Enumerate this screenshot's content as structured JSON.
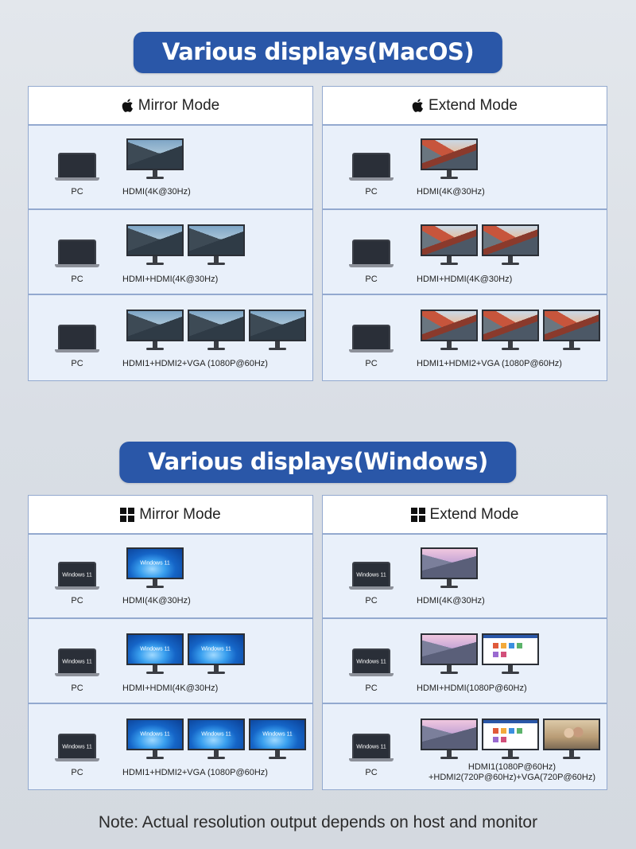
{
  "sections": [
    {
      "title": "Various displays(MacOS)",
      "os": "macos",
      "panels": [
        {
          "header": "Mirror Mode",
          "icon": "apple-icon",
          "rows": [
            {
              "pc_label": "PC",
              "connection": "HDMI(4K@30Hz)",
              "monitors": [
                "yosemite"
              ]
            },
            {
              "pc_label": "PC",
              "connection": "HDMI+HDMI(4K@30Hz)",
              "monitors": [
                "yosemite",
                "yosemite"
              ]
            },
            {
              "pc_label": "PC",
              "connection": "HDMI1+HDMI2+VGA (1080P@60Hz)",
              "monitors": [
                "yosemite",
                "yosemite",
                "yosemite"
              ]
            }
          ]
        },
        {
          "header": "Extend Mode",
          "icon": "apple-icon",
          "rows": [
            {
              "pc_label": "PC",
              "connection": "HDMI(4K@30Hz)",
              "monitors": [
                "sierra"
              ]
            },
            {
              "pc_label": "PC",
              "connection": "HDMI+HDMI(4K@30Hz)",
              "monitors": [
                "sierra",
                "sierra"
              ]
            },
            {
              "pc_label": "PC",
              "connection": "HDMI1+HDMI2+VGA (1080P@60Hz)",
              "monitors": [
                "sierra",
                "sierra",
                "sierra"
              ]
            }
          ]
        }
      ]
    },
    {
      "title": "Various displays(Windows)",
      "os": "windows",
      "panels": [
        {
          "header": "Mirror Mode",
          "icon": "windows-logo-icon",
          "rows": [
            {
              "pc_label": "PC",
              "connection": "HDMI(4K@30Hz)",
              "monitors": [
                "windows11"
              ]
            },
            {
              "pc_label": "PC",
              "connection": "HDMI+HDMI(4K@30Hz)",
              "monitors": [
                "windows11",
                "windows11"
              ]
            },
            {
              "pc_label": "PC",
              "connection": "HDMI1+HDMI2+VGA (1080P@60Hz)",
              "monitors": [
                "windows11",
                "windows11",
                "windows11"
              ]
            }
          ]
        },
        {
          "header": "Extend Mode",
          "icon": "windows-logo-icon",
          "rows": [
            {
              "pc_label": "PC",
              "connection": "HDMI(4K@30Hz)",
              "monitors": [
                "mountain"
              ]
            },
            {
              "pc_label": "PC",
              "connection": "HDMI+HDMI(1080P@60Hz)",
              "monitors": [
                "mountain",
                "webpage"
              ]
            },
            {
              "pc_label": "PC",
              "connection_line1": "HDMI1(1080P@60Hz)",
              "connection_line2": "+HDMI2(720P@60Hz)+VGA(720P@60Hz)",
              "monitors": [
                "mountain",
                "webpage",
                "photo"
              ]
            }
          ]
        }
      ]
    }
  ],
  "windows_wallpaper_text": "Windows 11",
  "note": "Note: Actual resolution output depends on host and monitor",
  "colors": {
    "title_bg": "#2a57a8",
    "panel_border": "#93a9cf",
    "row_bg": "#e9f0fa"
  }
}
